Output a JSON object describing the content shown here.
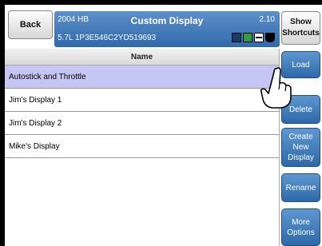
{
  "header": {
    "back_label": "Back",
    "year_model": "2004 HB",
    "vin_line": "5.7L  1P3E546C2YD519693",
    "title": "Custom Display",
    "version": "2.10",
    "show_shortcuts_label": "Show\nShortcuts"
  },
  "list": {
    "column_header": "Name",
    "rows": [
      "Autostick and Throttle",
      "Jim's Display 1",
      "Jim's Display 2",
      "Mike's Display"
    ],
    "selected_index": 0
  },
  "side_buttons": {
    "load": "Load",
    "delete": "Delete",
    "create": "Create\nNew\nDisplay",
    "rename": "Rename",
    "more": "More\nOptions"
  },
  "colors": {
    "accent": "#3a78bc",
    "selected_row": "#c6c6f5"
  },
  "icons": [
    "signal-icon",
    "battery-icon",
    "network-icon",
    "cup-icon"
  ]
}
